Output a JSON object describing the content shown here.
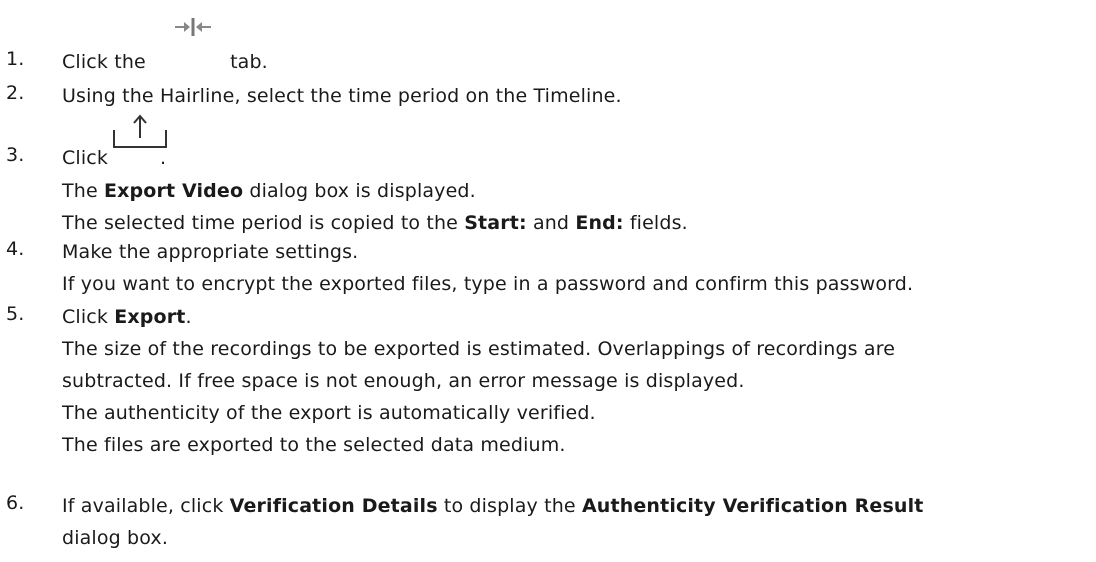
{
  "steps": [
    {
      "number": "1.",
      "before_icon": "Click the",
      "icon": "timeline-tab-icon",
      "after_icon": "tab."
    },
    {
      "number": "2.",
      "text": "Using the Hairline, select the time period on the Timeline."
    },
    {
      "number": "3.",
      "before_icon": "Click",
      "icon": "export-icon",
      "after_icon": ".",
      "lines": [
        {
          "t1": "The ",
          "b1": "Export Video",
          "t2": " dialog box is displayed."
        },
        {
          "t1": "The selected time period is copied to the ",
          "b1": "Start:",
          "t2": " and ",
          "b2": "End:",
          "t3": " fields."
        }
      ]
    },
    {
      "number": "4.",
      "text": "Make the appropriate settings.",
      "lines": [
        "If you want to encrypt the exported files, type in a password and confirm this password."
      ]
    },
    {
      "number": "5.",
      "t1": "Click ",
      "b1": "Export",
      "t2": ".",
      "lines": [
        "The size of the recordings to be exported is estimated. Overlappings of recordings are",
        "subtracted. If free space is not enough, an error message is displayed.",
        "The authenticity of the export is automatically verified.",
        "The files are exported to the selected data medium."
      ]
    },
    {
      "number": "6.",
      "t1": "If available, click ",
      "b1": "Verification Details",
      "t2": " to display the ",
      "b2": "Authenticity Verification Result",
      "line2": "dialog box."
    }
  ]
}
